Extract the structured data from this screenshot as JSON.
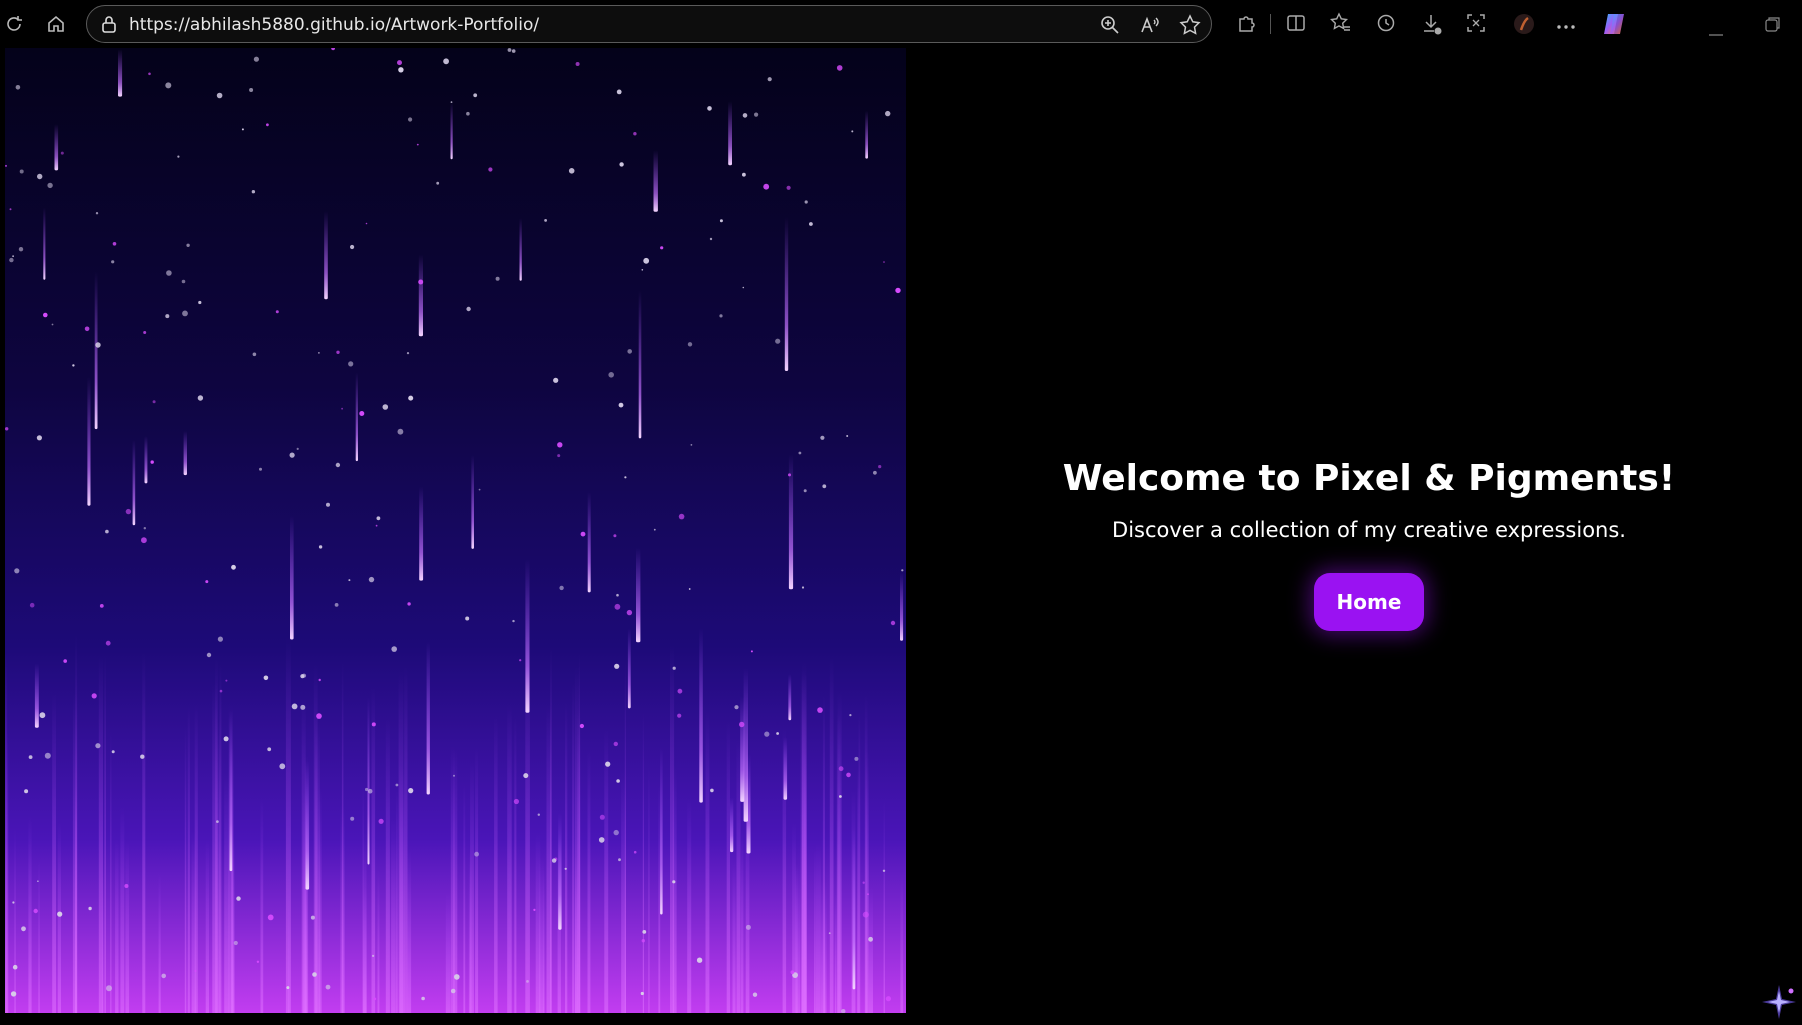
{
  "browser": {
    "url": "https://abhilash5880.github.io/Artwork-Portfolio/",
    "icons": {
      "reload": "reload-icon",
      "home": "home-icon",
      "lock": "lock-icon",
      "zoom": "zoom-icon",
      "read_aloud": "read-aloud-icon",
      "favorite": "star-icon",
      "extensions": "puzzle-icon",
      "split_screen": "split-screen-icon",
      "favorites": "favorites-icon",
      "history": "history-icon",
      "downloads": "download-icon",
      "screenshot": "screenshot-icon",
      "profile": "profile-icon",
      "more": "more-icon",
      "copilot": "copilot-icon",
      "minimize": "minimize-icon",
      "restore": "restore-icon"
    }
  },
  "hero": {
    "title": "Welcome to Pixel & Pigments!",
    "subtitle": "Discover a collection of my creative expressions.",
    "button_label": "Home"
  },
  "colors": {
    "accent": "#9a12f2",
    "background": "#000000",
    "art_top": "#05021a",
    "art_mid": "#1c0b6e",
    "art_bottom": "#c43cf2"
  }
}
